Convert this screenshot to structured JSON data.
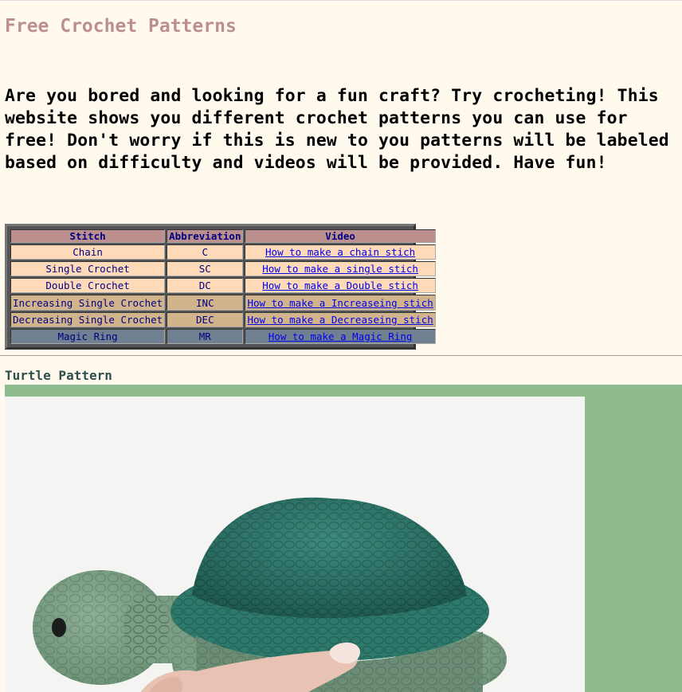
{
  "page": {
    "title": "Free Crochet Patterns",
    "intro": "Are you bored and looking for a fun craft? Try crocheting! This website shows you different crochet patterns you can use for free! Don't worry if this is new to you patterns will be labeled based on difficulty and videos will be provided. Have fun!"
  },
  "stitch_table": {
    "headers": [
      "Stitch",
      "Abbreviation",
      "Video"
    ],
    "rows": [
      {
        "stitch": "Chain",
        "abbr": "C",
        "video": "How to make a chain stich"
      },
      {
        "stitch": "Single Crochet",
        "abbr": "SC",
        "video": "How to make a single stich"
      },
      {
        "stitch": "Double Crochet",
        "abbr": "DC",
        "video": "How to make a Double stich"
      },
      {
        "stitch": "Increasing Single Crochet",
        "abbr": "INC",
        "video": "How to make a Increaseing stich"
      },
      {
        "stitch": "Decreasing Single Crochet",
        "abbr": "DEC",
        "video": "How to make a Decreaseing stich"
      },
      {
        "stitch": "Magic Ring",
        "abbr": "MR",
        "video": "How to make a Magic Ring"
      }
    ]
  },
  "turtle_section": {
    "title": "Turtle Pattern"
  },
  "colors": {
    "background": "#fff9ee",
    "title": "#bc8f8f",
    "header_cell": "#bc8f8f",
    "row_peach": "#ffdab9",
    "row_tan": "#d2b48c",
    "row_slate": "#708090",
    "section_title": "#2f4f4f",
    "green_band": "#8fbc8f",
    "link": "#0000ee"
  }
}
